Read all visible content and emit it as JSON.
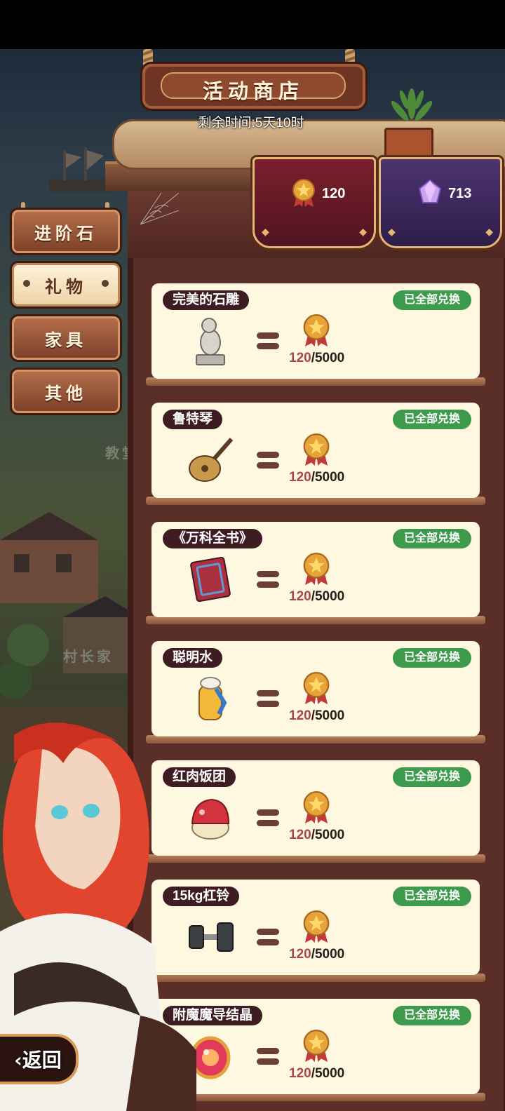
{
  "shop": {
    "title": "活动商店",
    "time_left": "剩余时间:5天10时"
  },
  "currency": {
    "medal": {
      "value": "120",
      "icon": "medal-icon",
      "color": "#e6a33a"
    },
    "crystal": {
      "value": "713",
      "icon": "crystal-icon",
      "color": "#c9a4f0"
    }
  },
  "tabs": [
    {
      "label": "进阶石",
      "active": false
    },
    {
      "label": "礼物",
      "active": true
    },
    {
      "label": "家具",
      "active": false
    },
    {
      "label": "其他",
      "active": false
    }
  ],
  "background_labels": {
    "school": "教堂",
    "chief_house": "村长家"
  },
  "items": [
    {
      "name": "完美的石雕",
      "status": "已全部兑换",
      "owned": "120",
      "required": "5000",
      "icon": "stone-statue-icon"
    },
    {
      "name": "鲁特琴",
      "status": "已全部兑换",
      "owned": "120",
      "required": "5000",
      "icon": "lute-icon"
    },
    {
      "name": "《万科全书》",
      "status": "已全部兑换",
      "owned": "120",
      "required": "5000",
      "icon": "book-icon"
    },
    {
      "name": "聪明水",
      "status": "已全部兑换",
      "owned": "120",
      "required": "5000",
      "icon": "potion-icon"
    },
    {
      "name": "红肉饭团",
      "status": "已全部兑换",
      "owned": "120",
      "required": "5000",
      "icon": "rice-ball-icon"
    },
    {
      "name": "15kg杠铃",
      "status": "已全部兑换",
      "owned": "120",
      "required": "5000",
      "icon": "dumbbell-icon"
    },
    {
      "name": "附魔魔导结晶",
      "status": "已全部兑换",
      "owned": "120",
      "required": "5000",
      "icon": "magic-crystal-icon"
    }
  ],
  "back_button": {
    "label": "返回"
  },
  "colors": {
    "badge": "#3e9a4c",
    "row_bg": "#fff8e1",
    "tag_bg": "#3e1d22",
    "price_owned": "#a5474b"
  }
}
